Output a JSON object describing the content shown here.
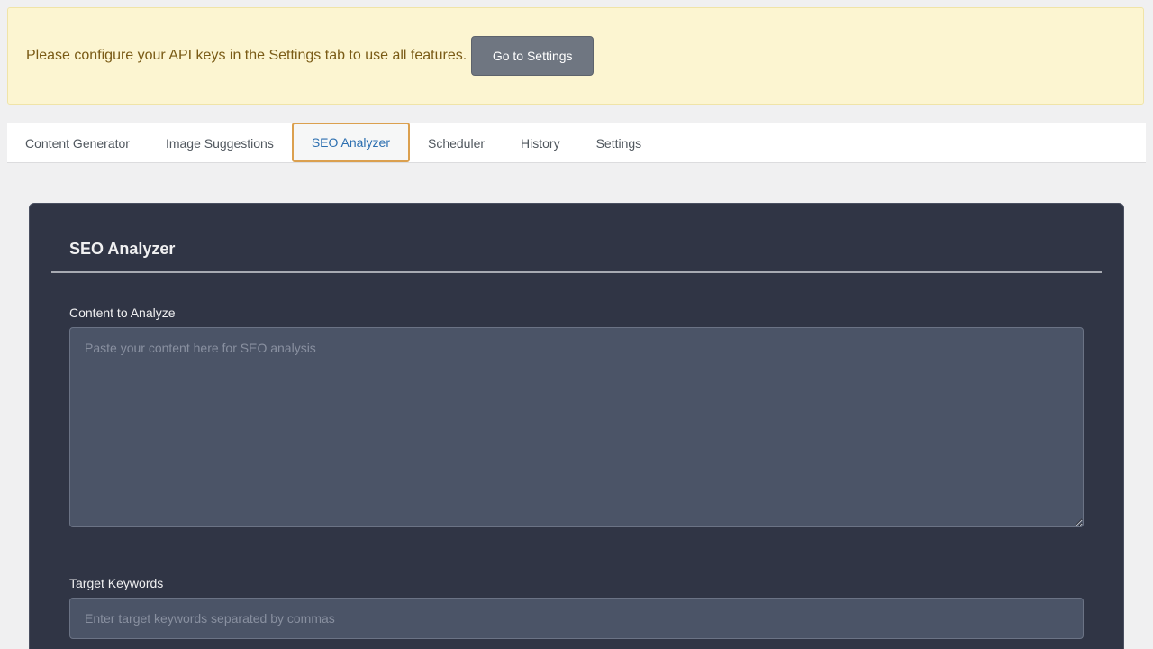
{
  "notice": {
    "message": "Please configure your API keys in the Settings tab to use all features.",
    "button_label": "Go to Settings"
  },
  "tabs": [
    {
      "label": "Content Generator",
      "active": false
    },
    {
      "label": "Image Suggestions",
      "active": false
    },
    {
      "label": "SEO Analyzer",
      "active": true
    },
    {
      "label": "Scheduler",
      "active": false
    },
    {
      "label": "History",
      "active": false
    },
    {
      "label": "Settings",
      "active": false
    }
  ],
  "panel": {
    "title": "SEO Analyzer",
    "content_label": "Content to Analyze",
    "content_placeholder": "Paste your content here for SEO analysis",
    "content_value": "",
    "keywords_label": "Target Keywords",
    "keywords_placeholder": "Enter target keywords separated by commas",
    "keywords_value": ""
  },
  "colors": {
    "notice_bg": "#fcf5d1",
    "notice_text": "#7a5b16",
    "active_tab_border": "#dba04f",
    "active_tab_text": "#2c6fb0",
    "panel_bg": "#303545",
    "input_bg": "#4b5467"
  }
}
